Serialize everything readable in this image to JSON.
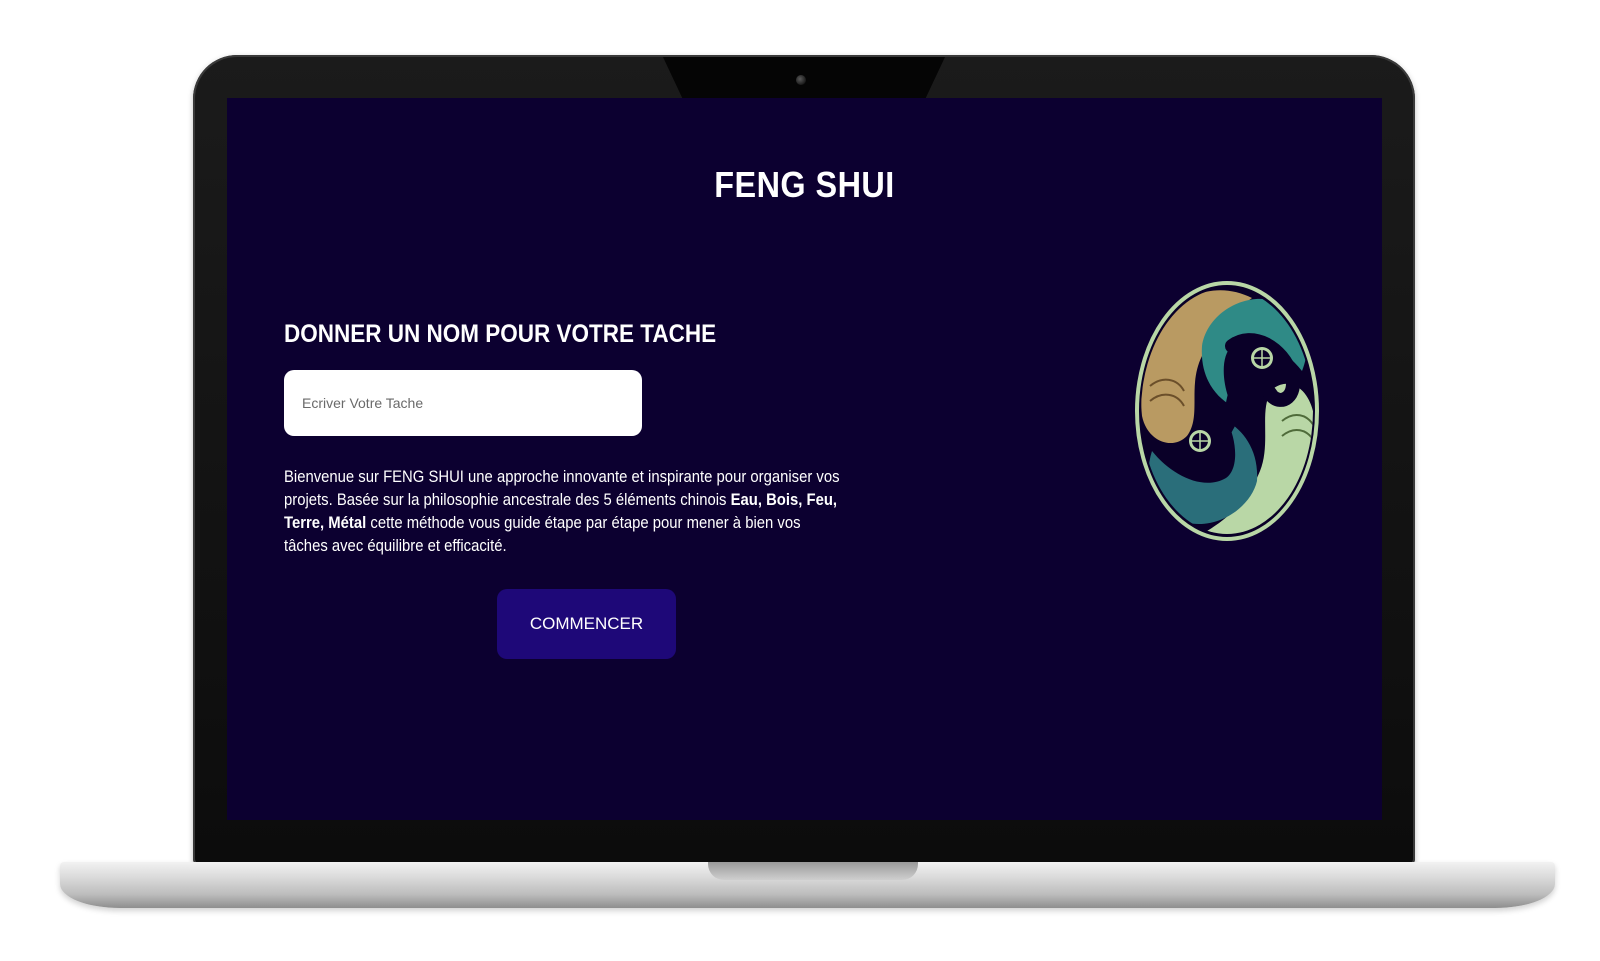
{
  "app": {
    "title": "FENG SHUI"
  },
  "form": {
    "heading": "DONNER UN NOM POUR VOTRE TACHE",
    "task_placeholder": "Ecriver Votre Tache",
    "task_value": ""
  },
  "description": {
    "line1": "Bienvenue sur FENG SHUI une approche innovante et inspirante pour organiser vos projets. Basée sur la philosophie ancestrale des 5 éléments chinois ",
    "elements": "Eau, Bois, Feu, Terre, Métal",
    "line2": " cette méthode vous guide étape par étape pour mener à bien vos tâches avec équilibre et efficacité."
  },
  "actions": {
    "start_label": "COMMENCER"
  },
  "colors": {
    "screen_background": "#0c0030",
    "button_background": "#1e0878",
    "logo_gold": "#b99a62",
    "logo_teal": "#2f8a86",
    "logo_sage": "#b9d7a6"
  },
  "icons": {
    "logo": "yin-yang-koi-logo"
  }
}
